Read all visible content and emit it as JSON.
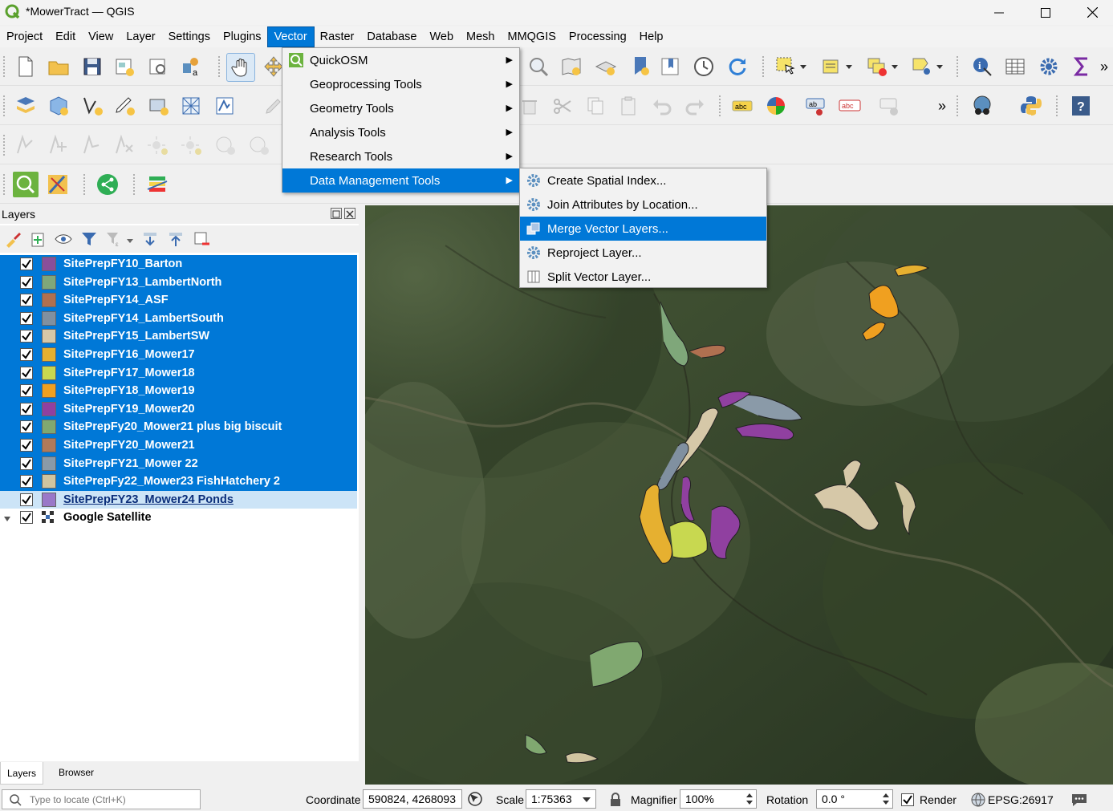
{
  "window": {
    "title": "*MowerTract — QGIS"
  },
  "menubar": {
    "items": [
      "Project",
      "Edit",
      "View",
      "Layer",
      "Settings",
      "Plugins",
      "Vector",
      "Raster",
      "Database",
      "Web",
      "Mesh",
      "MMQGIS",
      "Processing",
      "Help"
    ],
    "active": "Vector"
  },
  "vector_menu": {
    "items": [
      "QuickOSM",
      "Geoprocessing Tools",
      "Geometry Tools",
      "Analysis Tools",
      "Research Tools",
      "Data Management Tools"
    ],
    "highlighted": "Data Management Tools"
  },
  "data_mgmt_submenu": {
    "items": [
      "Create Spatial Index...",
      "Join Attributes by Location...",
      "Merge Vector Layers...",
      "Reproject Layer...",
      "Split Vector Layer..."
    ],
    "highlighted": "Merge Vector Layers..."
  },
  "layers_panel": {
    "title": "Layers",
    "layers": [
      {
        "name": "SitePrepFY10_Barton",
        "color": "#8a4f9a",
        "checked": true
      },
      {
        "name": "SitePrepFY13_LambertNorth",
        "color": "#7fa77a",
        "checked": true
      },
      {
        "name": "SitePrepFY14_ASF",
        "color": "#b07050",
        "checked": true
      },
      {
        "name": "SitePrepFY14_LambertSouth",
        "color": "#8090a0",
        "checked": true
      },
      {
        "name": "SitePrepFY15_LambertSW",
        "color": "#d6c8a8",
        "checked": true
      },
      {
        "name": "SitePrepFY16_Mower17",
        "color": "#e6b030",
        "checked": true
      },
      {
        "name": "SitePrepFY17_Mower18",
        "color": "#c8d850",
        "checked": true
      },
      {
        "name": "SitePrepFY18_Mower19",
        "color": "#f0a020",
        "checked": true
      },
      {
        "name": "SitePrepFY19_Mower20",
        "color": "#9040a0",
        "checked": true
      },
      {
        "name": "SitePrepFy20_Mower21 plus big biscuit",
        "color": "#80a870",
        "checked": true
      },
      {
        "name": "SitePrepFY20_Mower21",
        "color": "#b07a5a",
        "checked": true
      },
      {
        "name": "SitePrepFY21_Mower 22",
        "color": "#8a9aa8",
        "checked": true
      },
      {
        "name": "SitePrepFy22_Mower23 FishHatchery 2",
        "color": "#d0c4a0",
        "checked": true
      },
      {
        "name": "SitePrepFY23_Mower24 Ponds",
        "color": "#9a78c8",
        "checked": true
      }
    ],
    "basemap": {
      "name": "Google Satellite",
      "checked": true
    },
    "tabs": [
      "Layers",
      "Browser"
    ]
  },
  "statusbar": {
    "locate_placeholder": "Type to locate (Ctrl+K)",
    "coordinate_label": "Coordinate",
    "coordinate_value": "590824, 4268093",
    "scale_label": "Scale",
    "scale_value": "1:75363",
    "magnifier_label": "Magnifier",
    "magnifier_value": "100%",
    "rotation_label": "Rotation",
    "rotation_value": "0.0 °",
    "render_label": "Render",
    "crs": "EPSG:26917"
  }
}
